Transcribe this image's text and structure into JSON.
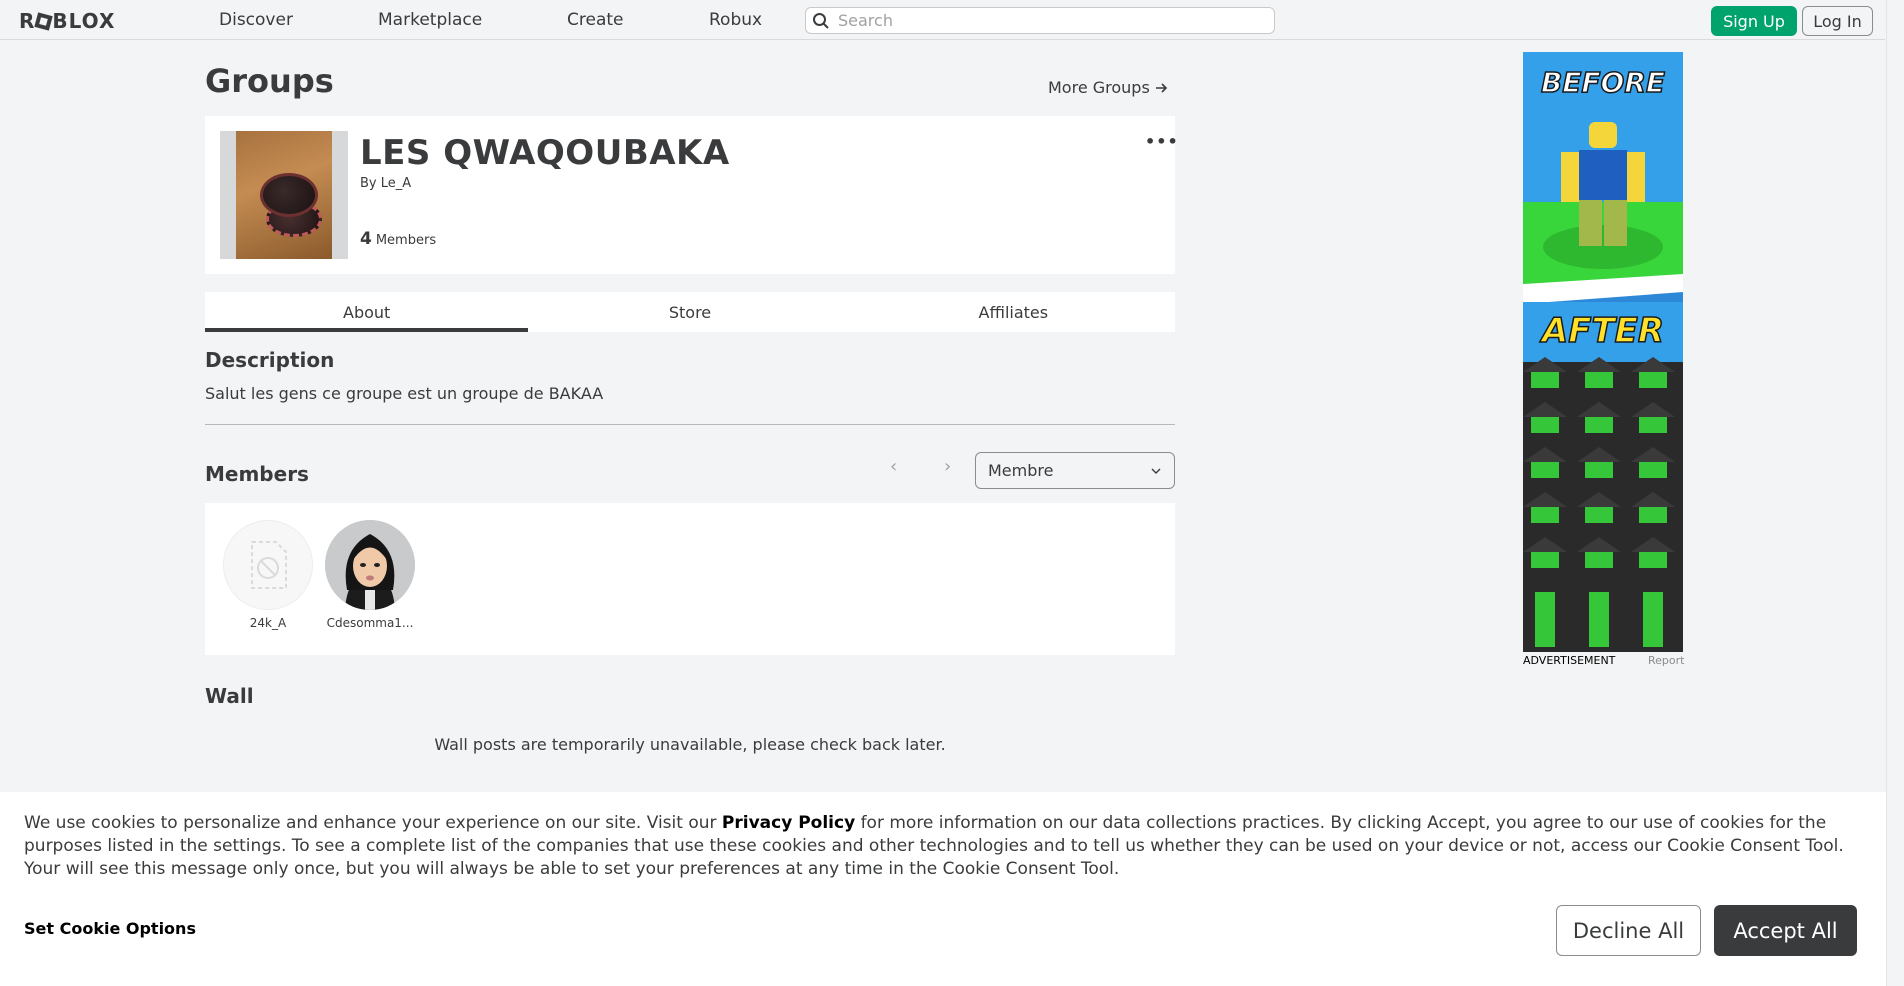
{
  "nav": {
    "logo": "ROBLOX",
    "links": [
      "Discover",
      "Marketplace",
      "Create",
      "Robux"
    ],
    "search_placeholder": "Search",
    "signup_label": "Sign Up",
    "login_label": "Log In"
  },
  "page": {
    "title": "Groups",
    "more_groups": "More Groups"
  },
  "group": {
    "name": "LES QWAQOUBAKA",
    "by_label": "By",
    "owner": "Le_A",
    "member_count": "4",
    "members_label": "Members"
  },
  "tabs": [
    "About",
    "Store",
    "Affiliates"
  ],
  "about": {
    "description_heading": "Description",
    "description": "Salut les gens ce groupe est un groupe de BAKAA",
    "members_heading": "Members",
    "role_selected": "Membre",
    "members": [
      {
        "name": "24k_A"
      },
      {
        "name": "Cdesomma1..."
      }
    ],
    "wall_heading": "Wall",
    "wall_message": "Wall posts are temporarily unavailable, please check back later."
  },
  "ad": {
    "before": "BEFORE",
    "after": "AFTER",
    "label": "ADVERTISEMENT",
    "report": "Report"
  },
  "cookie": {
    "text_before": "We use cookies to personalize and enhance your experience on our site. Visit our ",
    "privacy_link": "Privacy Policy",
    "text_after": " for more information on our data collections practices. By clicking Accept, you agree to our use of cookies for the purposes listed in the settings. To see a complete list of the companies that use these cookies and other technologies and to tell us whether they can be used on your device or not, access our Cookie Consent Tool. Your will see this message only once, but you will always be able to set your preferences at any time in the Cookie Consent Tool.",
    "options_label": "Set Cookie Options",
    "decline_label": "Decline All",
    "accept_label": "Accept All"
  },
  "colors": {
    "signup_green": "#00a36b",
    "accept_dark": "#393b3d",
    "page_bg": "#f2f4f5"
  }
}
